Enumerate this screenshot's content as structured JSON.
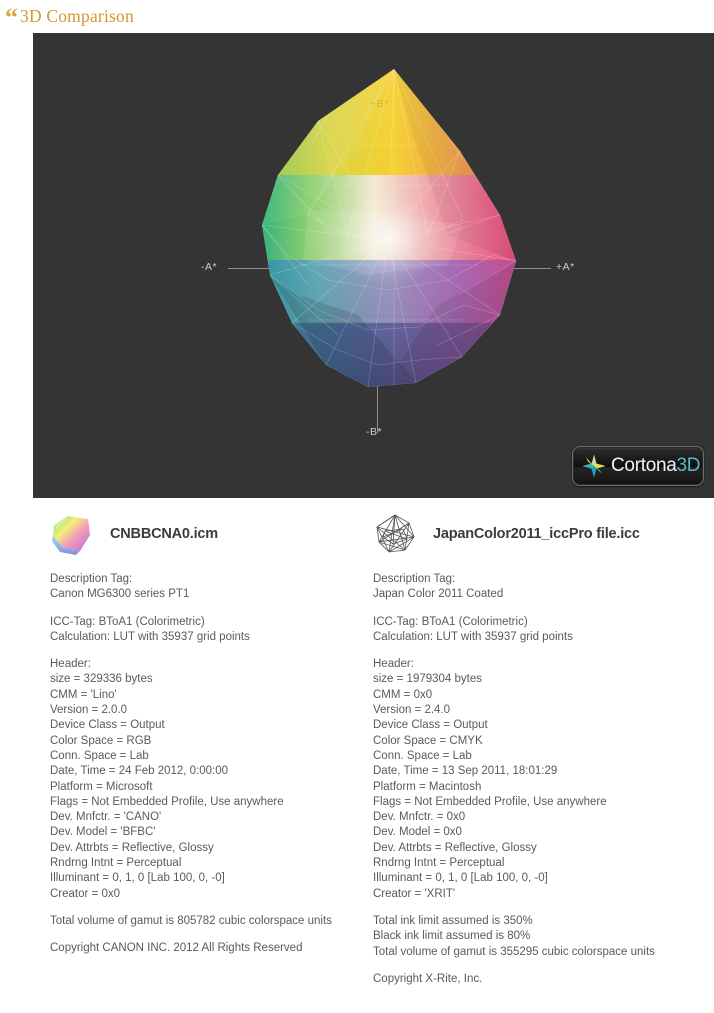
{
  "page": {
    "title": "3D Comparison",
    "quote_glyph": "“"
  },
  "viewer": {
    "background_color": "#343434",
    "axes": {
      "minus_a": "-A*",
      "plus_a": "+A*",
      "minus_b": "-B*",
      "plus_b": "+B*"
    },
    "branding": {
      "word": "Cortona",
      "suffix": "3D",
      "accent_color": "#55b9c4"
    }
  },
  "profiles": [
    {
      "icon": "color-gamut-solid-icon",
      "filename": "CNBBCNA0.icm",
      "description_label": "Description Tag:",
      "description_value": "Canon MG6300 series PT1",
      "icc_tag": "ICC-Tag: BToA1 (Colorimetric)",
      "calculation": "Calculation: LUT with 35937 grid points",
      "header_label": "Header:",
      "header_lines": [
        "size = 329336 bytes",
        "CMM = 'Lino'",
        "Version = 2.0.0",
        "Device Class = Output",
        "Color Space = RGB",
        "Conn. Space = Lab",
        "Date, Time = 24 Feb 2012, 0:00:00",
        "Platform = Microsoft",
        "Flags = Not Embedded Profile, Use anywhere",
        "Dev. Mnfctr. = 'CANO'",
        "Dev. Model = 'BFBC'",
        "Dev. Attrbts = Reflective, Glossy",
        "Rndrng Intnt = Perceptual",
        "Illuminant = 0, 1, 0 [Lab 100, 0, -0]",
        "Creator = 0x0"
      ],
      "summary_lines": [
        "Total volume of gamut is 805782 cubic colorspace units"
      ],
      "copyright_lines": [
        "Copyright CANON INC. 2012 All Rights Reserved"
      ]
    },
    {
      "icon": "wireframe-gamut-icon",
      "filename": "JapanColor2011_iccPro file.icc",
      "description_label": "Description Tag:",
      "description_value": "Japan Color 2011 Coated",
      "icc_tag": "ICC-Tag: BToA1 (Colorimetric)",
      "calculation": "Calculation: LUT with 35937 grid points",
      "header_label": "Header:",
      "header_lines": [
        "size = 1979304 bytes",
        "CMM = 0x0",
        "Version = 2.4.0",
        "Device Class = Output",
        "Color Space = CMYK",
        "Conn. Space = Lab",
        "Date, Time = 13 Sep 2011, 18:01:29",
        "Platform = Macintosh",
        "Flags = Not Embedded Profile, Use anywhere",
        "Dev. Mnfctr. = 0x0",
        "Dev. Model = 0x0",
        "Dev. Attrbts = Reflective, Glossy",
        "Rndrng Intnt = Perceptual",
        "Illuminant = 0, 1, 0 [Lab 100, 0, -0]",
        "Creator = 'XRIT'"
      ],
      "summary_lines": [
        "Total ink limit assumed is 350%",
        "Black ink limit assumed is 80%",
        "Total volume of gamut is 355295 cubic colorspace units"
      ],
      "copyright_lines": [
        "Copyright X-Rite, Inc."
      ]
    }
  ]
}
